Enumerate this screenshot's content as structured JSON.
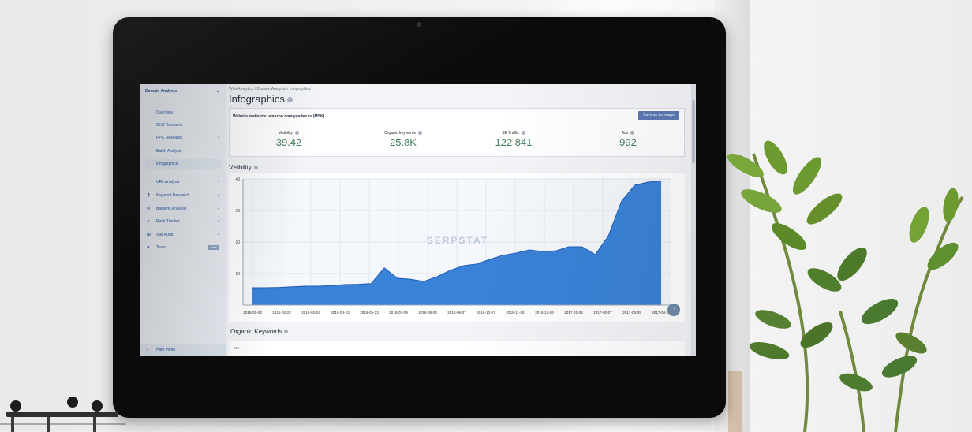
{
  "sidebar": {
    "header": "Domain Analysis",
    "items": [
      {
        "label": "Overview"
      },
      {
        "label": "SEO Research"
      },
      {
        "label": "PPC Research"
      },
      {
        "label": "Batch Analysis"
      },
      {
        "label": "Infographics"
      },
      {
        "label": "URL Analysis"
      },
      {
        "label": "Keyword Research"
      },
      {
        "label": "Backlink Analysis"
      },
      {
        "label": "Rank Tracker"
      },
      {
        "label": "Site Audit"
      },
      {
        "label": "Tools"
      }
    ],
    "tools_badge": "New",
    "hide_menu": "Hide menu"
  },
  "main": {
    "breadcrumb": "Web Analytics / Domain Analysis / Infographics",
    "title": "Infographics",
    "stats_caption": "Website statistics: amazon.com/yandex.ru (MSK)",
    "save_button": "Save as an image",
    "stats": [
      {
        "label": "Visibility",
        "value": "39.42"
      },
      {
        "label": "Organic keywords",
        "value": "25.8K"
      },
      {
        "label": "SE Traffic",
        "value": "122 841"
      },
      {
        "label": "Ads",
        "value": "992"
      }
    ],
    "visibility_title": "Visibility",
    "watermark": "SERPSTAT",
    "organic_title": "Organic Keywords",
    "organic_first_tick": "70K",
    "scroll_up": "↑"
  },
  "chart_data": {
    "type": "area",
    "title": "Visibility",
    "xlabel": "",
    "ylabel": "",
    "ylim": [
      0,
      40
    ],
    "yticks": [
      "10",
      "20",
      "30",
      "40"
    ],
    "grid": true,
    "color": "#2f7bd6",
    "x_tick_labels": [
      "2016-01-03",
      "2016-02-23",
      "2016-03-24",
      "2016-04-23",
      "2016-05-23",
      "2016-07-09",
      "2016-08-08",
      "2016-09-07",
      "2016-10-07",
      "2016-11-06",
      "2016-12-06",
      "2017-01-05",
      "2017-02-07",
      "2017-03-09",
      "2017-04-14"
    ],
    "series": [
      {
        "values": [
          5.5,
          5.5,
          5.6,
          5.8,
          6.0,
          6.0,
          6.2,
          6.5,
          6.6,
          6.8,
          11.8,
          8.5,
          8.2,
          7.5,
          9.0,
          11.0,
          12.5,
          13.0,
          14.5,
          15.8,
          16.5,
          17.5,
          17.0,
          17.2,
          18.5,
          18.5,
          16.0,
          22.0,
          33.0,
          38.0,
          39.0,
          39.4
        ]
      }
    ]
  }
}
